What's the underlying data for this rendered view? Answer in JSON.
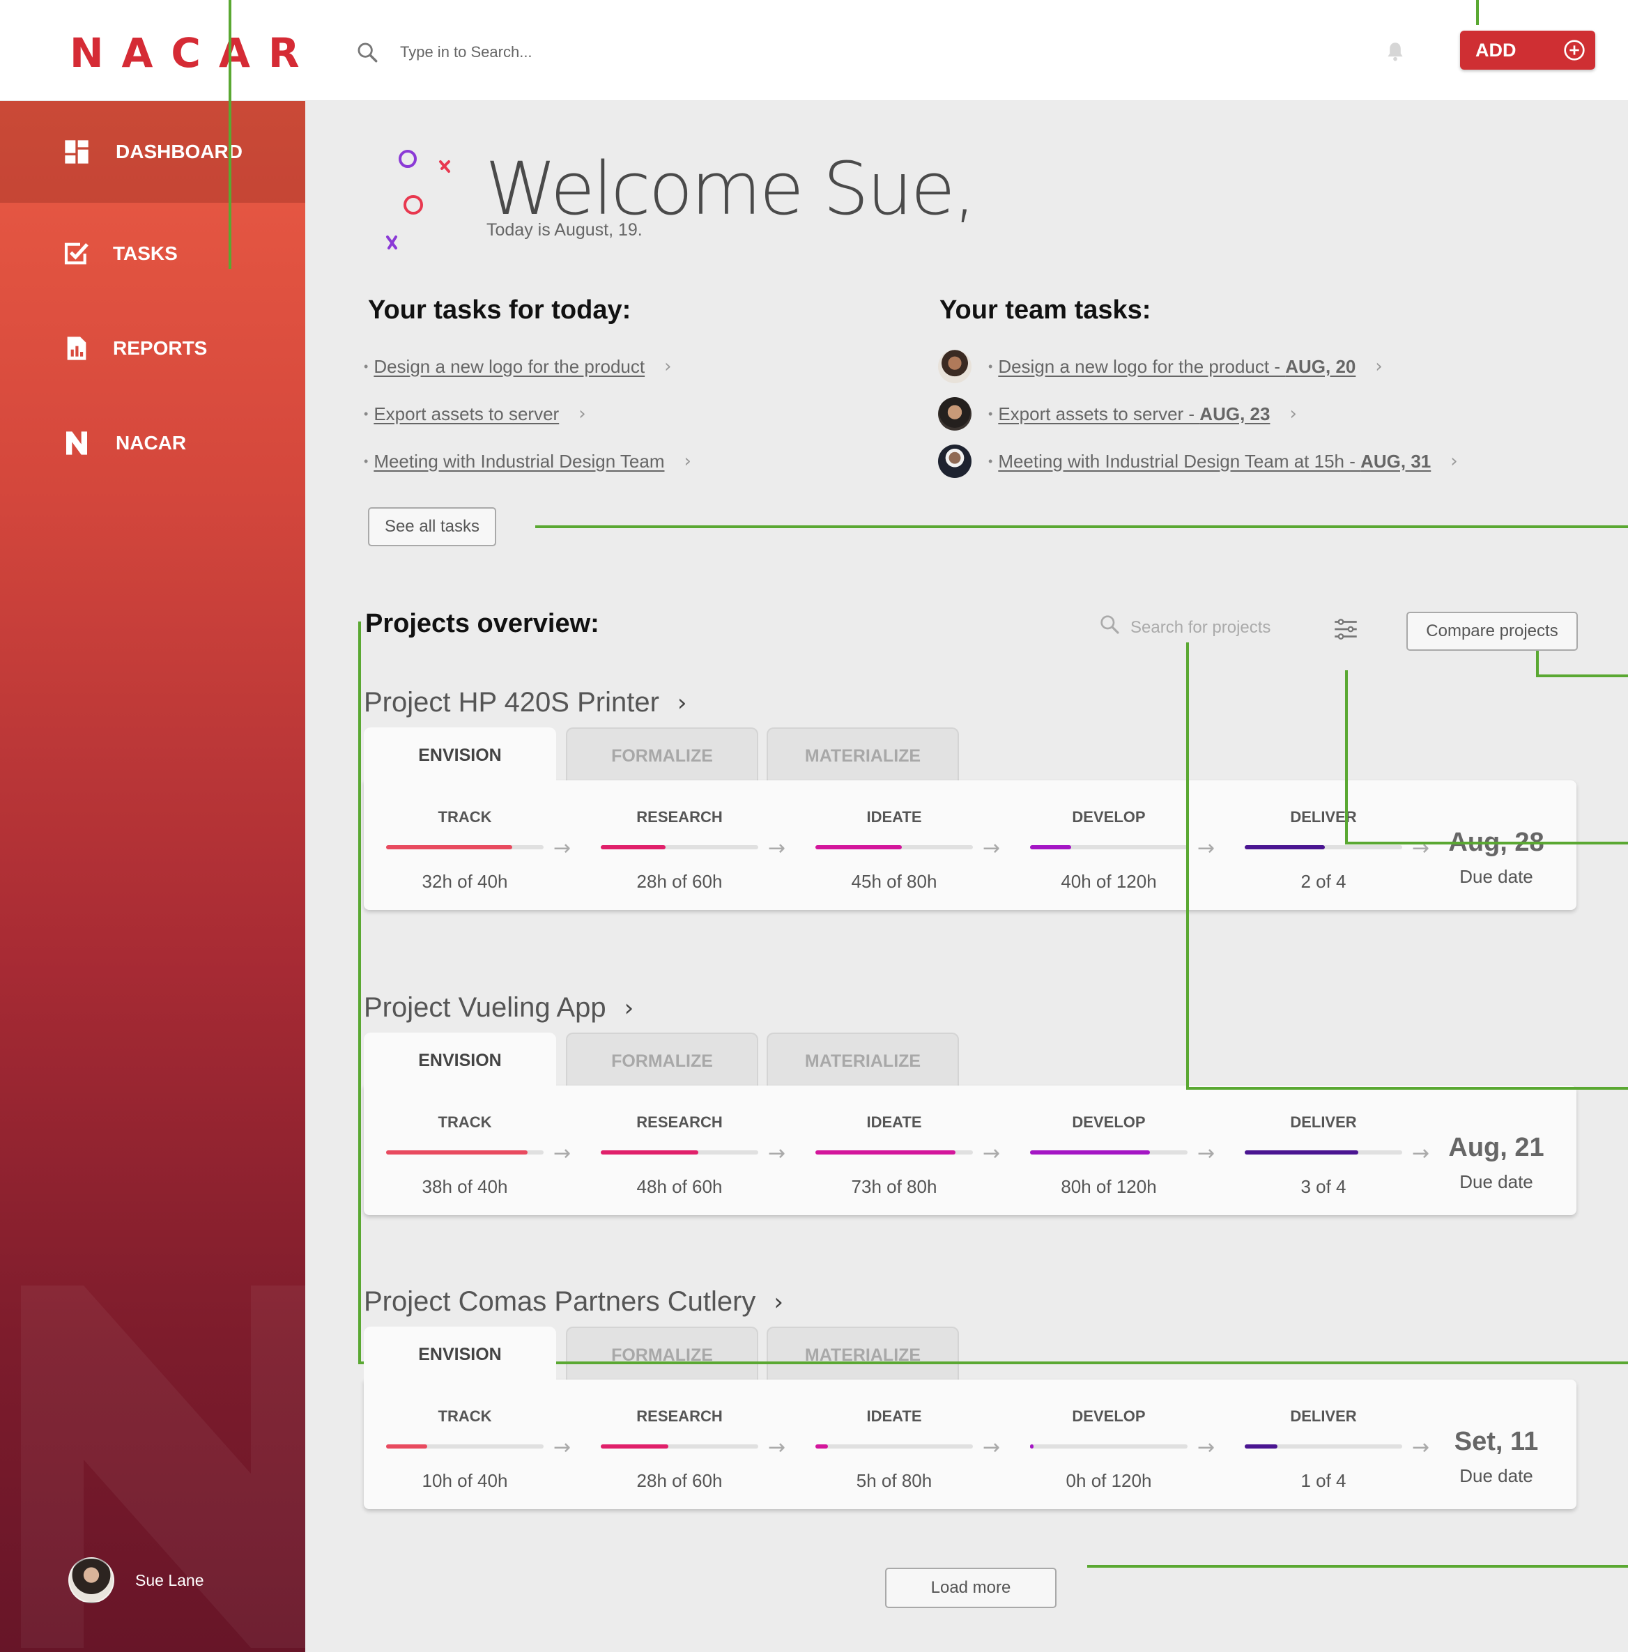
{
  "header": {
    "logo": "NACAR",
    "search_placeholder": "Type in to Search...",
    "add_label": "ADD"
  },
  "sidebar": {
    "items": [
      {
        "label": "DASHBOARD",
        "icon": "dashboard-icon"
      },
      {
        "label": "TASKS",
        "icon": "checkbox-icon"
      },
      {
        "label": "REPORTS",
        "icon": "report-icon"
      },
      {
        "label": "NACAR",
        "icon": "nacar-n-icon"
      }
    ],
    "user_name": "Sue Lane"
  },
  "welcome": {
    "title": "Welcome Sue,",
    "subtitle": "Today is August, 19."
  },
  "my_tasks": {
    "title": "Your tasks for today:",
    "items": [
      "Design a new logo for the product",
      "Export assets to server",
      "Meeting with Industrial Design Team"
    ],
    "see_all": "See all tasks"
  },
  "team_tasks": {
    "title": "Your team tasks:",
    "items": [
      {
        "text": "Design a new logo for the product - ",
        "date": "AUG, 20"
      },
      {
        "text": "Export assets to server - ",
        "date": "AUG, 23"
      },
      {
        "text": "Meeting with Industrial Design Team at 15h - ",
        "date": "AUG, 31"
      }
    ]
  },
  "projects_overview": {
    "title": "Projects overview:",
    "search_placeholder": "Search for projects",
    "compare_label": "Compare projects",
    "load_more": "Load more"
  },
  "tabs": [
    "ENVISION",
    "FORMALIZE",
    "MATERIALIZE"
  ],
  "stage_names": [
    "TRACK",
    "RESEARCH",
    "IDEATE",
    "DEVELOP",
    "DELIVER"
  ],
  "stage_colors": [
    "#e84a5f",
    "#e0206a",
    "#d3169b",
    "#a416c4",
    "#4a1591"
  ],
  "due_label": "Due date",
  "projects": [
    {
      "name": "Project HP 420S Printer",
      "due": "Aug, 28",
      "stages": [
        {
          "value": "32h of 40h",
          "progress": 0.8
        },
        {
          "value": "28h of 60h",
          "progress": 0.41
        },
        {
          "value": "45h of 80h",
          "progress": 0.55
        },
        {
          "value": "40h of 120h",
          "progress": 0.26
        },
        {
          "value": "2 of 4",
          "progress": 0.51
        }
      ]
    },
    {
      "name": "Project Vueling App",
      "due": "Aug, 21",
      "stages": [
        {
          "value": "38h of 40h",
          "progress": 0.9
        },
        {
          "value": "48h of 60h",
          "progress": 0.62
        },
        {
          "value": "73h of 80h",
          "progress": 0.89
        },
        {
          "value": "80h of 120h",
          "progress": 0.76
        },
        {
          "value": "3 of 4",
          "progress": 0.72
        }
      ]
    },
    {
      "name": "Project Comas Partners Cutlery",
      "due": "Set, 11",
      "stages": [
        {
          "value": "10h of 40h",
          "progress": 0.26
        },
        {
          "value": "28h of 60h",
          "progress": 0.43
        },
        {
          "value": "5h of 80h",
          "progress": 0.08
        },
        {
          "value": "0h of 120h",
          "progress": 0.02
        },
        {
          "value": "1 of 4",
          "progress": 0.21
        }
      ]
    }
  ]
}
